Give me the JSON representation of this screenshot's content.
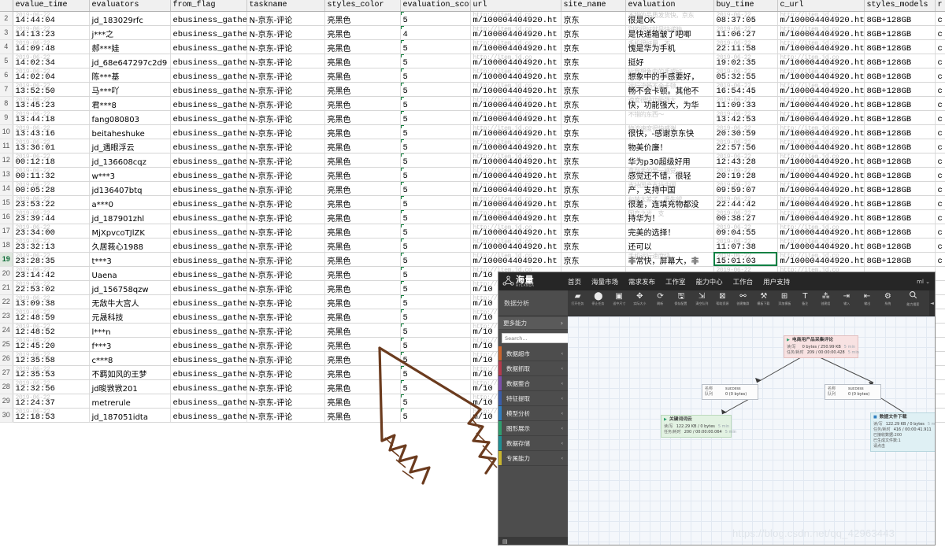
{
  "spreadsheet": {
    "columns": [
      "evalue_time",
      "evaluators",
      "from_flag",
      "taskname",
      "styles_color",
      "evaluation_scores",
      "url",
      "site_name",
      "evaluation",
      "buy_time",
      "c_url",
      "styles_models",
      "r"
    ],
    "ghost_date": "2019-06-22",
    "ghost_url": "http://item.jd.co",
    "selected_cell": {
      "row": 19,
      "column": "buy_time",
      "value": "15:01:03"
    },
    "rows": [
      {
        "n": 2,
        "evalue_time": "14:44:04",
        "evaluators": "jd_183029rfc",
        "from_flag": "ebusiness_gather",
        "taskname": "N-京东-评论",
        "styles_color": "亮黑色",
        "evaluation_scores": "5",
        "url": "m/100004404920.ht",
        "site_name": "京东",
        "evaluation": "很是OK",
        "ghost_eval": "不错的品质发货快，京东",
        "buy_time": "08:37:05",
        "c_url": "m/100004404920.ht",
        "styles_models": "8GB+128GB",
        "r": "c"
      },
      {
        "n": 3,
        "evalue_time": "14:13:23",
        "evaluators": "j***之",
        "from_flag": "ebusiness_gather",
        "taskname": "N-京东-评论",
        "styles_color": "亮黑色",
        "evaluation_scores": "4",
        "url": "m/100004404920.ht",
        "site_name": "京东",
        "evaluation": "是快递箱皱了吧唧",
        "ghost_eval": "别的很好就是快递箱",
        "buy_time": "11:06:27",
        "c_url": "m/100004404920.ht",
        "styles_models": "8GB+128GB",
        "r": "c"
      },
      {
        "n": 4,
        "evalue_time": "14:09:48",
        "evaluators": "郝***娃",
        "from_flag": "ebusiness_gather",
        "taskname": "N-京东-评论",
        "styles_color": "亮黑色",
        "evaluation_scores": "5",
        "url": "m/100004404920.ht",
        "site_name": "京东",
        "evaluation": "愧是华为手机",
        "ghost_eval": "手机很好用，不",
        "buy_time": "22:11:58",
        "c_url": "m/100004404920.ht",
        "styles_models": "8GB+128GB",
        "r": "c"
      },
      {
        "n": 5,
        "evalue_time": "14:02:34",
        "evaluators": "jd_68e647297c2d9",
        "from_flag": "ebusiness_gather",
        "taskname": "N-京东-评论",
        "styles_color": "亮黑色",
        "evaluation_scores": "5",
        "url": "m/100004404920.ht",
        "site_name": "京东",
        "evaluation": "挺好",
        "ghost_eval": "",
        "buy_time": "19:02:35",
        "c_url": "m/100004404920.ht",
        "styles_models": "8GB+128GB",
        "r": "c"
      },
      {
        "n": 6,
        "evalue_time": "14:02:04",
        "evaluators": "陈***基",
        "from_flag": "ebusiness_gather",
        "taskname": "N-京东-评论",
        "styles_color": "亮黑色",
        "evaluation_scores": "5",
        "url": "m/100004404920.ht",
        "site_name": "京东",
        "evaluation": "想象中的手感要好，",
        "ghost_eval": "比我想象中的手感好",
        "buy_time": "05:32:55",
        "c_url": "m/100004404920.ht",
        "styles_models": "8GB+128GB",
        "r": "c"
      },
      {
        "n": 7,
        "evalue_time": "13:52:50",
        "evaluators": "马***吖",
        "from_flag": "ebusiness_gather",
        "taskname": "N-京东-评论",
        "styles_color": "亮黑色",
        "evaluation_scores": "5",
        "url": "m/100004404920.ht",
        "site_name": "京东",
        "evaluation": "畅不会卡顿。其他不",
        "ghost_eval": "运行流畅不会卡顿",
        "buy_time": "16:54:45",
        "c_url": "m/100004404920.ht",
        "styles_models": "8GB+128GB",
        "r": "c"
      },
      {
        "n": 8,
        "evalue_time": "13:45:23",
        "evaluators": "君***8",
        "from_flag": "ebusiness_gather",
        "taskname": "N-京东-评论",
        "styles_color": "亮黑色",
        "evaluation_scores": "5",
        "url": "m/100004404920.ht",
        "site_name": "京东",
        "evaluation": "快，功能强大，为华",
        "ghost_eval": "速度很快功能强大",
        "buy_time": "11:09:33",
        "c_url": "m/100004404920.ht",
        "styles_models": "8GB+128GB",
        "r": "c"
      },
      {
        "n": 9,
        "evalue_time": "13:44:18",
        "evaluators": "fang080803",
        "from_flag": "ebusiness_gather",
        "taskname": "N-京东-评论",
        "styles_color": "亮黑色",
        "evaluation_scores": "5",
        "url": "m/100004404920.ht",
        "site_name": "京东",
        "evaluation": "",
        "ghost_eval": "不错的东西～",
        "buy_time": "13:42:53",
        "c_url": "m/100004404920.ht",
        "styles_models": "8GB+128GB",
        "r": "c"
      },
      {
        "n": 10,
        "evalue_time": "13:43:16",
        "evaluators": "beitaheshuke",
        "from_flag": "ebusiness_gather",
        "taskname": "N-京东-评论",
        "styles_color": "亮黑色",
        "evaluation_scores": "5",
        "url": "m/100004404920.ht",
        "site_name": "京东",
        "evaluation": "很快，-感谢京东快",
        "ghost_eval": "物流速度很快感谢",
        "buy_time": "20:30:59",
        "c_url": "m/100004404920.ht",
        "styles_models": "8GB+128GB",
        "r": "c"
      },
      {
        "n": 11,
        "evalue_time": "13:36:01",
        "evaluators": "jd_遇眼浮云",
        "from_flag": "ebusiness_gather",
        "taskname": "N-京东-评论",
        "styles_color": "亮黑色",
        "evaluation_scores": "5",
        "url": "m/100004404920.ht",
        "site_name": "京东",
        "evaluation": "物美价廉！",
        "ghost_eval": "",
        "buy_time": "22:57:56",
        "c_url": "m/100004404920.ht",
        "styles_models": "8GB+128GB",
        "r": "c"
      },
      {
        "n": 12,
        "evalue_time": "00:12:18",
        "evaluators": "jd_136608cqz",
        "from_flag": "ebusiness_gather",
        "taskname": "N-京东-评论",
        "styles_color": "亮黑色",
        "evaluation_scores": "5",
        "url": "m/100004404920.ht",
        "site_name": "京东",
        "evaluation": "华为p30超级好用",
        "ghost_eval": "",
        "buy_time": "12:43:28",
        "c_url": "m/100004404920.ht",
        "styles_models": "8GB+128GB",
        "r": "c"
      },
      {
        "n": 13,
        "evalue_time": "00:11:32",
        "evaluators": "w***3",
        "from_flag": "ebusiness_gather",
        "taskname": "N-京东-评论",
        "styles_color": "亮黑色",
        "evaluation_scores": "5",
        "url": "m/100004404920.ht",
        "site_name": "京东",
        "evaluation": "感觉还不错，很轻",
        "ghost_eval": "拿到手的第一感觉",
        "buy_time": "20:19:28",
        "c_url": "m/100004404920.ht",
        "styles_models": "8GB+128GB",
        "r": "c"
      },
      {
        "n": 14,
        "evalue_time": "00:05:28",
        "evaluators": "jd136407btq",
        "from_flag": "ebusiness_gather",
        "taskname": "N-京东-评论",
        "styles_color": "亮黑色",
        "evaluation_scores": "5",
        "url": "m/100004404920.ht",
        "site_name": "京东",
        "evaluation": "产，支持中国",
        "ghost_eval": "支持国产支持中国",
        "buy_time": "09:59:07",
        "c_url": "m/100004404920.ht",
        "styles_models": "8GB+128GB",
        "r": "c"
      },
      {
        "n": 15,
        "evalue_time": "23:53:22",
        "evaluators": "a***0",
        "from_flag": "ebusiness_gather",
        "taskname": "N-京东-评论",
        "styles_color": "亮黑色",
        "evaluation_scores": "5",
        "url": "m/100004404920.ht",
        "site_name": "京东",
        "evaluation": "很差，连填充物都没",
        "ghost_eval": "包装太差了，很失望",
        "buy_time": "22:44:42",
        "c_url": "m/100004404920.ht",
        "styles_models": "8GB+128GB",
        "r": "c"
      },
      {
        "n": 16,
        "evalue_time": "23:39:44",
        "evaluators": "jd_187901zhl",
        "from_flag": "ebusiness_gather",
        "taskname": "N-京东-评论",
        "styles_color": "亮黑色",
        "evaluation_scores": "5",
        "url": "m/100004404920.ht",
        "site_name": "京东",
        "evaluation": "持华为！",
        "ghost_eval": "国产之光，支",
        "buy_time": "00:38:27",
        "c_url": "m/100004404920.ht",
        "styles_models": "8GB+128GB",
        "r": "c"
      },
      {
        "n": 17,
        "evalue_time": "23:34:00",
        "evaluators": "MjXpvcoTJlZK",
        "from_flag": "ebusiness_gather",
        "taskname": "N-京东-评论",
        "styles_color": "亮黑色",
        "evaluation_scores": "5",
        "url": "m/100004404920.ht",
        "site_name": "京东",
        "evaluation": "完美的选择！",
        "ghost_eval": "",
        "buy_time": "09:04:55",
        "c_url": "m/100004404920.ht",
        "styles_models": "8GB+128GB",
        "r": "c"
      },
      {
        "n": 18,
        "evalue_time": "23:32:13",
        "evaluators": "久居莪心1988",
        "from_flag": "ebusiness_gather",
        "taskname": "N-京东-评论",
        "styles_color": "亮黑色",
        "evaluation_scores": "5",
        "url": "m/100004404920.ht",
        "site_name": "京东",
        "evaluation": "还可以",
        "ghost_eval": "",
        "buy_time": "11:07:38",
        "c_url": "m/100004404920.ht",
        "styles_models": "8GB+128GB",
        "r": "c"
      },
      {
        "n": 19,
        "evalue_time": "23:28:35",
        "evaluators": "t***3",
        "from_flag": "ebusiness_gather",
        "taskname": "N-京东-评论",
        "styles_color": "亮黑色",
        "evaluation_scores": "5",
        "url": "m/100004404920.ht",
        "site_name": "京东",
        "evaluation": "非常快，屏幕大，非",
        "ghost_eval": "手机运行速度快",
        "buy_time": "15:01:03",
        "c_url": "m/100004404920.ht",
        "styles_models": "8GB+128GB",
        "r": "c"
      },
      {
        "n": 20,
        "evalue_time": "23:14:42",
        "evaluators": "Uaena",
        "from_flag": "ebusiness_gather",
        "taskname": "N-京东-评论",
        "styles_color": "亮黑色",
        "evaluation_scores": "5",
        "url": "m/10",
        "site_name": "",
        "evaluation": "",
        "ghost_eval": "",
        "buy_time": "",
        "c_url": "",
        "styles_models": "",
        "r": ""
      },
      {
        "n": 21,
        "evalue_time": "22:53:02",
        "evaluators": "jd_156758qzw",
        "from_flag": "ebusiness_gather",
        "taskname": "N-京东-评论",
        "styles_color": "亮黑色",
        "evaluation_scores": "5",
        "url": "m/10",
        "site_name": "",
        "evaluation": "",
        "ghost_eval": "",
        "buy_time": "",
        "c_url": "",
        "styles_models": "",
        "r": ""
      },
      {
        "n": 22,
        "evalue_time": "13:09:38",
        "evaluators": "无敌牛大宫人",
        "from_flag": "ebusiness_gather",
        "taskname": "N-京东-评论",
        "styles_color": "亮黑色",
        "evaluation_scores": "5",
        "url": "m/10",
        "site_name": "",
        "evaluation": "",
        "ghost_eval": "",
        "buy_time": "",
        "c_url": "",
        "styles_models": "",
        "r": ""
      },
      {
        "n": 23,
        "evalue_time": "12:48:59",
        "evaluators": "元晟科技",
        "from_flag": "ebusiness_gather",
        "taskname": "N-京东-评论",
        "styles_color": "亮黑色",
        "evaluation_scores": "5",
        "url": "m/10",
        "site_name": "",
        "evaluation": "",
        "ghost_eval": "",
        "buy_time": "",
        "c_url": "",
        "styles_models": "",
        "r": ""
      },
      {
        "n": 24,
        "evalue_time": "12:48:52",
        "evaluators": "l***n",
        "from_flag": "ebusiness_gather",
        "taskname": "N-京东-评论",
        "styles_color": "亮黑色",
        "evaluation_scores": "5",
        "url": "m/10",
        "site_name": "",
        "evaluation": "",
        "ghost_eval": "",
        "buy_time": "",
        "c_url": "",
        "styles_models": "",
        "r": ""
      },
      {
        "n": 25,
        "evalue_time": "12:45:20",
        "evaluators": "f***3",
        "from_flag": "ebusiness_gather",
        "taskname": "N-京东-评论",
        "styles_color": "亮黑色",
        "evaluation_scores": "5",
        "url": "m/10",
        "site_name": "",
        "evaluation": "",
        "ghost_eval": "",
        "buy_time": "",
        "c_url": "",
        "styles_models": "",
        "r": ""
      },
      {
        "n": 26,
        "evalue_time": "12:35:58",
        "evaluators": "c***8",
        "from_flag": "ebusiness_gather",
        "taskname": "N-京东-评论",
        "styles_color": "亮黑色",
        "evaluation_scores": "5",
        "url": "m/10",
        "site_name": "",
        "evaluation": "",
        "ghost_eval": "",
        "buy_time": "",
        "c_url": "",
        "styles_models": "",
        "r": ""
      },
      {
        "n": 27,
        "evalue_time": "12:35:53",
        "evaluators": "不羁如风的王梦",
        "from_flag": "ebusiness_gather",
        "taskname": "N-京东-评论",
        "styles_color": "亮黑色",
        "evaluation_scores": "5",
        "url": "m/10",
        "site_name": "",
        "evaluation": "",
        "ghost_eval": "",
        "buy_time": "",
        "c_url": "",
        "styles_models": "",
        "r": ""
      },
      {
        "n": 28,
        "evalue_time": "12:32:56",
        "evaluators": "jd晙敩敩201",
        "from_flag": "ebusiness_gather",
        "taskname": "N-京东-评论",
        "styles_color": "亮黑色",
        "evaluation_scores": "5",
        "url": "m/10",
        "site_name": "",
        "evaluation": "",
        "ghost_eval": "",
        "buy_time": "",
        "c_url": "",
        "styles_models": "",
        "r": ""
      },
      {
        "n": 29,
        "evalue_time": "12:24:37",
        "evaluators": "metrerule",
        "from_flag": "ebusiness_gather",
        "taskname": "N-京东-评论",
        "styles_color": "亮黑色",
        "evaluation_scores": "5",
        "url": "m/10",
        "site_name": "",
        "evaluation": "",
        "ghost_eval": "",
        "buy_time": "",
        "c_url": "",
        "styles_models": "",
        "r": ""
      },
      {
        "n": 30,
        "evalue_time": "12:18:53",
        "evaluators": "jd_187051idta",
        "from_flag": "ebusiness_gather",
        "taskname": "N-京东-评论",
        "styles_color": "亮黑色",
        "evaluation_scores": "5",
        "url": "m/10",
        "site_name": "",
        "evaluation": "",
        "ghost_eval": "",
        "buy_time": "",
        "c_url": "",
        "styles_models": "",
        "r": ""
      }
    ]
  },
  "app": {
    "brand": {
      "cn": "海量",
      "en": "HYLANDA",
      "reg": "®"
    },
    "nav": [
      "首页",
      "海量市场",
      "需求发布",
      "工作室",
      "能力中心",
      "工作台",
      "用户支持"
    ],
    "nav_right": "ml",
    "module_label": "数据分析",
    "toolbar": [
      {
        "label": "打开任务",
        "icon": "folder-icon",
        "glyph": "▰"
      },
      {
        "label": "停止任务",
        "icon": "stop-icon",
        "glyph": "⬤"
      },
      {
        "label": "适中尺寸",
        "icon": "fit-size-icon",
        "glyph": "▣"
      },
      {
        "label": "实际大小",
        "icon": "actual-size-icon",
        "glyph": "✥"
      },
      {
        "label": "刷新",
        "icon": "refresh-icon",
        "glyph": "⟳"
      },
      {
        "label": "保存配置",
        "icon": "save-icon",
        "glyph": "🖫"
      },
      {
        "label": "清空队列",
        "icon": "clear-queue-icon",
        "glyph": "⇲"
      },
      {
        "label": "帮助资源",
        "icon": "help-icon",
        "glyph": "⊠"
      },
      {
        "label": "创建集群",
        "icon": "create-cluster-icon",
        "glyph": "⚯"
      },
      {
        "label": "模板下载",
        "icon": "template-download-icon",
        "glyph": "⚒"
      },
      {
        "label": "添加模板",
        "icon": "add-template-icon",
        "glyph": "⊞"
      },
      {
        "label": "备注",
        "icon": "note-icon",
        "glyph": "T"
      },
      {
        "label": "创建组",
        "icon": "create-group-icon",
        "glyph": "⁂"
      },
      {
        "label": "输入",
        "icon": "input-icon",
        "glyph": "⇥"
      },
      {
        "label": "输出",
        "icon": "output-icon",
        "glyph": "⇤"
      },
      {
        "label": "系统",
        "icon": "system-icon",
        "glyph": "⚙"
      }
    ],
    "toolbar_search": {
      "label": "能力搜索",
      "icon": "search-icon",
      "glyph": "🔍"
    },
    "sidebar": {
      "more_label": "更多能力",
      "search_placeholder": "Search...",
      "items": [
        {
          "label": "数据超市",
          "color": "#c8632e"
        },
        {
          "label": "数据抓取",
          "color": "#b43a4c"
        },
        {
          "label": "数据整合",
          "color": "#7b4ea8"
        },
        {
          "label": "特征提取",
          "color": "#3a5ca8"
        },
        {
          "label": "模型分析",
          "color": "#2f7ec0"
        },
        {
          "label": "图形展示",
          "color": "#2f9e6e"
        },
        {
          "label": "数据存储",
          "color": "#1f8f93"
        },
        {
          "label": "专属能力",
          "color": "#c8b52e"
        }
      ]
    },
    "flow_nodes": [
      {
        "id": "source",
        "title": "电商用产品采集评论",
        "style": "pink",
        "marker": "▶",
        "rows": [
          {
            "k": "读/写",
            "v": "0 bytes / 250.99 KB",
            "t": "5 min"
          },
          {
            "k": "任务/耗时",
            "v": "209 / 00:00:00.428",
            "t": "5 min"
          }
        ],
        "extra": []
      },
      {
        "id": "success-left",
        "title": "",
        "style": "white",
        "marker": "",
        "rows": [
          {
            "k": "名称",
            "v": "success",
            "t": ""
          },
          {
            "k": "队列",
            "v": "0 (0 bytes)",
            "t": ""
          }
        ],
        "extra": []
      },
      {
        "id": "success-right",
        "title": "",
        "style": "white",
        "marker": "",
        "rows": [
          {
            "k": "名称",
            "v": "success",
            "t": ""
          },
          {
            "k": "队列",
            "v": "0 (0 bytes)",
            "t": ""
          }
        ],
        "extra": []
      },
      {
        "id": "wordcloud",
        "title": "关键词词云",
        "style": "green",
        "marker": "▶",
        "rows": [
          {
            "k": "读/写",
            "v": "122.29 KB / 0 bytes",
            "t": "5 min"
          },
          {
            "k": "任务/耗时",
            "v": "200 / 00:00:00.064",
            "t": "5 min"
          }
        ],
        "extra": []
      },
      {
        "id": "filedownload",
        "title": "数据文件下载",
        "style": "blue",
        "marker": "■",
        "rows": [
          {
            "k": "读/写",
            "v": "122.29 KB / 0 bytes",
            "t": "5 min"
          },
          {
            "k": "任务/耗时",
            "v": "416 / 00:00:41.911",
            "t": "5 min"
          }
        ],
        "extra": [
          "已接收数据:200",
          "已生成文件数:1",
          "请点击"
        ]
      }
    ],
    "statusbar": "▤"
  },
  "watermark": "https://blog.csdn.net/qq_42963443",
  "annotation": {
    "type": "hand-drawn-arrow",
    "color": "#6b3b1e"
  }
}
